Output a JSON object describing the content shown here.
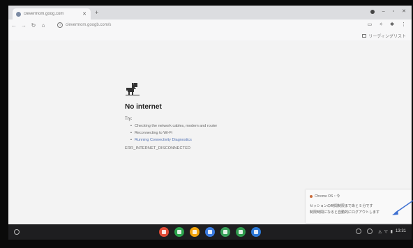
{
  "browser": {
    "tab": {
      "title": "clevermom.goog.com"
    },
    "newtab_label": "+",
    "url": "clevermom.googb.com/s",
    "reading_list_label": "リーディングリスト"
  },
  "error_page": {
    "title": "No internet",
    "try_label": "Try:",
    "suggestions": [
      "Checking the network cables, modem and router",
      "Reconnecting to Wi-Fi",
      "Running Connectivity Diagnostics"
    ],
    "error_code": "ERR_INTERNET_DISCONNECTED"
  },
  "notification": {
    "header": "Chrome OS・今",
    "line1": "セッションの時間制限まであと 5 分です",
    "line2": "制限時間になると自動的にログアウトします"
  },
  "shelf": {
    "apps": [
      {
        "name": "chrome",
        "color": "#e04b36"
      },
      {
        "name": "sheets",
        "color": "#2aa24a"
      },
      {
        "name": "slides",
        "color": "#f2a40b"
      },
      {
        "name": "docs",
        "color": "#3a7be0"
      },
      {
        "name": "drive",
        "color": "#3aa05a"
      },
      {
        "name": "classroom",
        "color": "#2e9a4c"
      },
      {
        "name": "meet",
        "color": "#2b78d6"
      }
    ],
    "clock": "13:31"
  }
}
